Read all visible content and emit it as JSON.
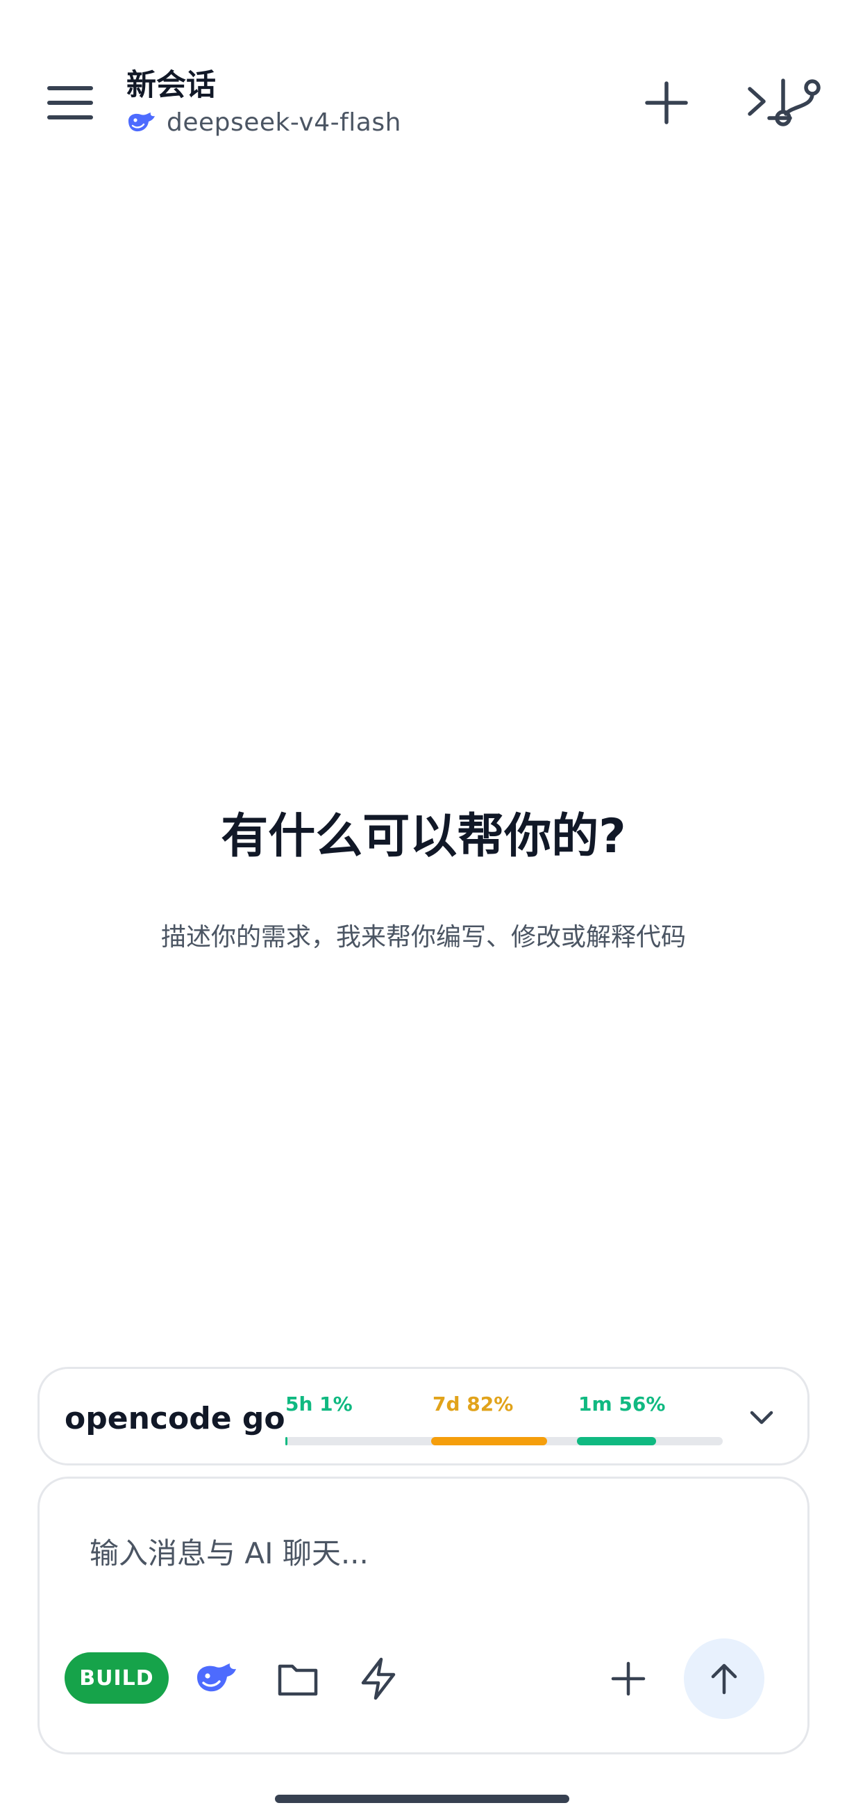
{
  "header": {
    "title": "新会话",
    "model": "deepseek-v4-flash",
    "icons": [
      "menu-icon",
      "plus-icon",
      "git-branch-icon",
      "terminal-icon"
    ]
  },
  "empty_state": {
    "title": "有什么可以帮你的?",
    "subtitle": "描述你的需求，我来帮你编写、修改或解释代码"
  },
  "usage": {
    "provider": "opencode go",
    "meters": [
      {
        "label": "5h 1%",
        "percent": 1,
        "color": "#10b981"
      },
      {
        "label": "7d 82%",
        "percent": 82,
        "color": "#f59e0b"
      },
      {
        "label": "1m 56%",
        "percent": 56,
        "color": "#10b981"
      }
    ]
  },
  "composer": {
    "placeholder": "输入消息与 AI 聊天...",
    "mode_label": "BUILD",
    "mode_color": "#16a34a",
    "accent_color": "#5b6ef0",
    "icons": [
      "deepseek-whale-icon",
      "folder-icon",
      "lightning-icon",
      "plus-icon",
      "arrow-up-icon"
    ]
  }
}
